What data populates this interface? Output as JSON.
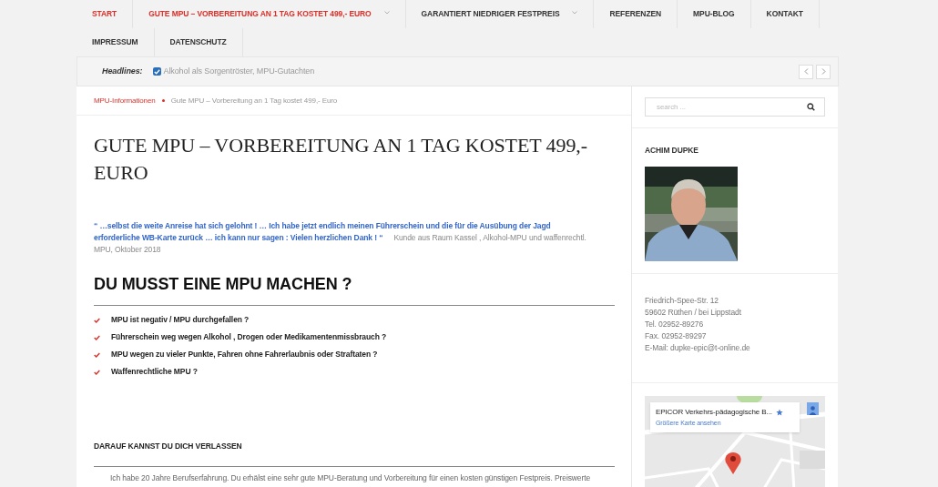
{
  "nav": {
    "items": [
      {
        "label": "START",
        "active": true,
        "has_submenu": false
      },
      {
        "label": "GUTE MPU – VORBEREITUNG AN 1 TAG KOSTET 499,- EURO",
        "active": true,
        "has_submenu": true
      },
      {
        "label": "GARANTIERT NIEDRIGER FESTPREIS",
        "active": false,
        "has_submenu": true
      },
      {
        "label": "REFERENZEN",
        "active": false,
        "has_submenu": false
      },
      {
        "label": "MPU-BLOG",
        "active": false,
        "has_submenu": false
      },
      {
        "label": "KONTAKT",
        "active": false,
        "has_submenu": false
      },
      {
        "label": "IMPRESSUM",
        "active": false,
        "has_submenu": false
      },
      {
        "label": "DATENSCHUTZ",
        "active": false,
        "has_submenu": false
      }
    ]
  },
  "headlines": {
    "label": "Headlines:",
    "checked": true,
    "text": "Alkohol als Sorgentröster, MPU-Gutachten"
  },
  "breadcrumb": {
    "parent": "MPU-Informationen",
    "current": "Gute MPU – Vorbereitung an 1 Tag kostet 499,- Euro"
  },
  "article": {
    "title": "GUTE MPU – VORBEREITUNG AN 1 TAG KOSTET 499,- EURO",
    "quote": "“ …selbst die weite Anreise hat sich gelohnt ! … Ich habe jetzt endlich meinen Führerschein und die für die Ausübung der Jagd erforderliche WB-Karte zurück … ich kann nur sagen : Vielen herzlichen Dank ! “",
    "quote_source": "Kunde aus Raum Kassel , Alkohol-MPU und waffenrechtl. MPU, Oktober 2018",
    "heading": "DU MUSST EINE MPU MACHEN ?",
    "checklist": [
      "MPU ist negativ / MPU durchgefallen ?",
      "Führerschein weg wegen Alkohol , Drogen oder Medikamentenmissbrauch ?",
      "MPU wegen zu vieler Punkte, Fahren ohne Fahrerlaubnis oder Straftaten ?",
      "Waffenrechtliche MPU ?"
    ],
    "subheading": "DARAUF KANNST DU DICH VERLASSEN",
    "paragraph": "Ich habe 20 Jahre Berufserfahrung. Du erhälst eine sehr gute MPU-Beratung und Vorbereitung für einen kosten günstigen Festpreis. Preiswerte"
  },
  "sidebar": {
    "search": {
      "placeholder": "search ..."
    },
    "profile": {
      "title": "ACHIM DUPKE"
    },
    "address": [
      "Friedrich-Spee-Str. 12",
      "59602 Rüthen / bei Lippstadt",
      "Tel. 02952-89276",
      "Fax. 02952-89297",
      "E-Mail: dupke-epic@t-online.de"
    ],
    "map": {
      "place": "EPICOR Verkehrs-pädagogische B...",
      "link": "Größere Karte ansehen"
    }
  }
}
